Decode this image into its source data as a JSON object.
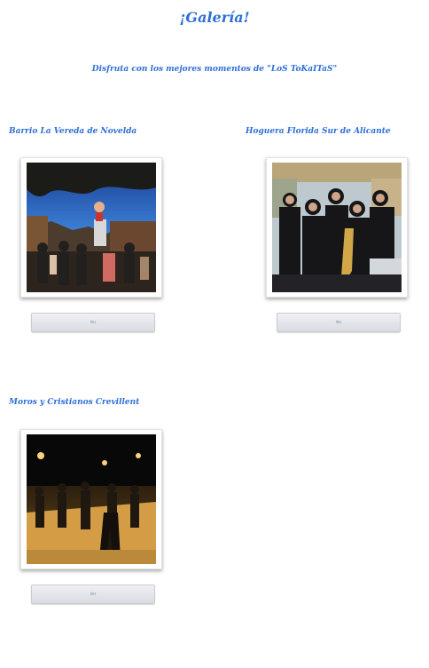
{
  "page": {
    "title": "¡Galería!",
    "subtitle": "Disfruta con los mejores momentos de \"LoS ToKaITaS\"",
    "footer": ""
  },
  "gallery": [
    {
      "title": "Barrio La Vereda de Novelda",
      "button_label": "Ver"
    },
    {
      "title": "Hoguera Florida Sur de Alicante",
      "button_label": "Ver"
    },
    {
      "title": "Moros y Cristianos Crevillent",
      "button_label": "Ver"
    }
  ],
  "colors": {
    "accent": "#2f6fd6",
    "button": "#dfe2e8"
  }
}
